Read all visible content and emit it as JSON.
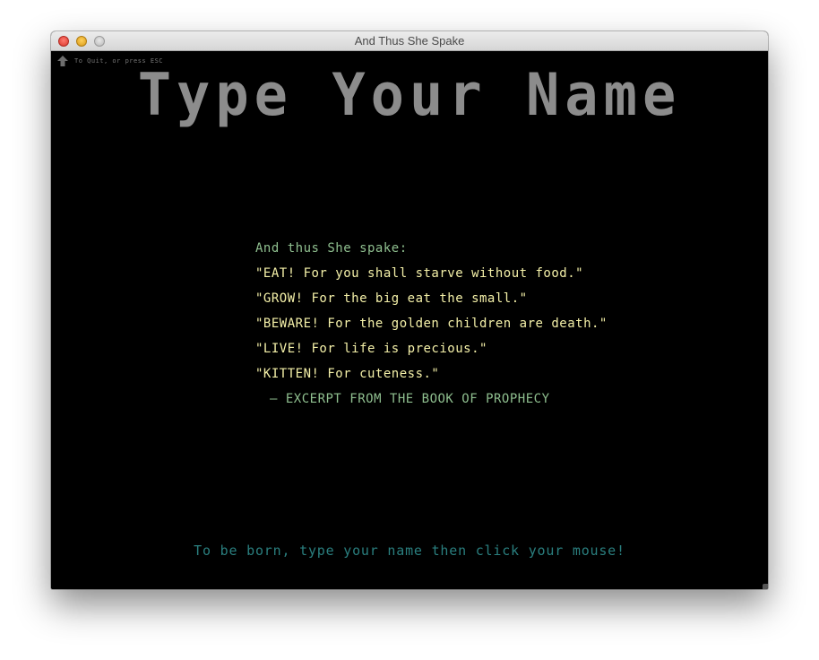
{
  "window": {
    "title": "And Thus She Spake"
  },
  "quit_hint": {
    "icon": "up-arrow-icon",
    "label": "To Quit, or press ESC"
  },
  "heading": "Type Your Name",
  "quote": {
    "intro": "And thus She spake:",
    "lines": [
      "\"EAT!  For you shall starve without food.\"",
      "\"GROW!  For the big eat the small.\"",
      "\"BEWARE!  For the golden children are death.\"",
      "\"LIVE!  For life is precious.\"",
      "\"KITTEN!  For cuteness.\""
    ],
    "attribution": "— EXCERPT FROM THE BOOK OF PROPHECY"
  },
  "prompt": "To be born, type your name then click your mouse!",
  "colors": {
    "background": "#000000",
    "heading": "#8c8c8c",
    "intro": "#8fbf8f",
    "quote_lines": "#f4f0a8",
    "prompt": "#2a7f7f"
  }
}
